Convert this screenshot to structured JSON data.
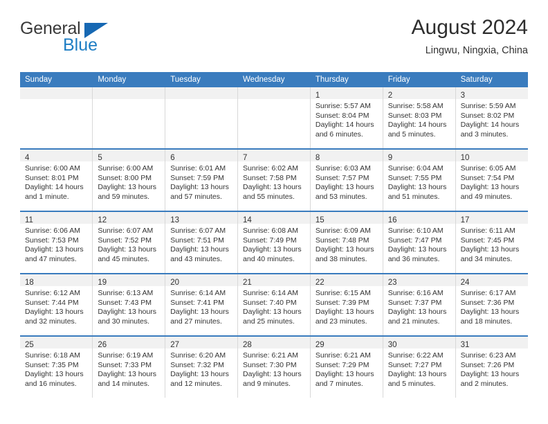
{
  "brand": {
    "name_part1": "General",
    "name_part2": "Blue",
    "triangle_color": "#1668b3",
    "blue_color": "#1f7ec4"
  },
  "header": {
    "title": "August 2024",
    "subtitle": "Lingwu, Ningxia, China"
  },
  "theme": {
    "header_blue": "#3a7cbe",
    "daynum_strip": "#f1f1f1",
    "text": "#333333"
  },
  "weekday_headers": [
    "Sunday",
    "Monday",
    "Tuesday",
    "Wednesday",
    "Thursday",
    "Friday",
    "Saturday"
  ],
  "labels": {
    "sunrise_prefix": "Sunrise:",
    "sunset_prefix": "Sunset:",
    "daylight_prefix": "Daylight:"
  },
  "weeks": [
    [
      {
        "day": "",
        "empty": true
      },
      {
        "day": "",
        "empty": true
      },
      {
        "day": "",
        "empty": true
      },
      {
        "day": "",
        "empty": true
      },
      {
        "day": "1",
        "sunrise": "Sunrise: 5:57 AM",
        "sunset": "Sunset: 8:04 PM",
        "daylight": "Daylight: 14 hours and 6 minutes."
      },
      {
        "day": "2",
        "sunrise": "Sunrise: 5:58 AM",
        "sunset": "Sunset: 8:03 PM",
        "daylight": "Daylight: 14 hours and 5 minutes."
      },
      {
        "day": "3",
        "sunrise": "Sunrise: 5:59 AM",
        "sunset": "Sunset: 8:02 PM",
        "daylight": "Daylight: 14 hours and 3 minutes."
      }
    ],
    [
      {
        "day": "4",
        "sunrise": "Sunrise: 6:00 AM",
        "sunset": "Sunset: 8:01 PM",
        "daylight": "Daylight: 14 hours and 1 minute."
      },
      {
        "day": "5",
        "sunrise": "Sunrise: 6:00 AM",
        "sunset": "Sunset: 8:00 PM",
        "daylight": "Daylight: 13 hours and 59 minutes."
      },
      {
        "day": "6",
        "sunrise": "Sunrise: 6:01 AM",
        "sunset": "Sunset: 7:59 PM",
        "daylight": "Daylight: 13 hours and 57 minutes."
      },
      {
        "day": "7",
        "sunrise": "Sunrise: 6:02 AM",
        "sunset": "Sunset: 7:58 PM",
        "daylight": "Daylight: 13 hours and 55 minutes."
      },
      {
        "day": "8",
        "sunrise": "Sunrise: 6:03 AM",
        "sunset": "Sunset: 7:57 PM",
        "daylight": "Daylight: 13 hours and 53 minutes."
      },
      {
        "day": "9",
        "sunrise": "Sunrise: 6:04 AM",
        "sunset": "Sunset: 7:55 PM",
        "daylight": "Daylight: 13 hours and 51 minutes."
      },
      {
        "day": "10",
        "sunrise": "Sunrise: 6:05 AM",
        "sunset": "Sunset: 7:54 PM",
        "daylight": "Daylight: 13 hours and 49 minutes."
      }
    ],
    [
      {
        "day": "11",
        "sunrise": "Sunrise: 6:06 AM",
        "sunset": "Sunset: 7:53 PM",
        "daylight": "Daylight: 13 hours and 47 minutes."
      },
      {
        "day": "12",
        "sunrise": "Sunrise: 6:07 AM",
        "sunset": "Sunset: 7:52 PM",
        "daylight": "Daylight: 13 hours and 45 minutes."
      },
      {
        "day": "13",
        "sunrise": "Sunrise: 6:07 AM",
        "sunset": "Sunset: 7:51 PM",
        "daylight": "Daylight: 13 hours and 43 minutes."
      },
      {
        "day": "14",
        "sunrise": "Sunrise: 6:08 AM",
        "sunset": "Sunset: 7:49 PM",
        "daylight": "Daylight: 13 hours and 40 minutes."
      },
      {
        "day": "15",
        "sunrise": "Sunrise: 6:09 AM",
        "sunset": "Sunset: 7:48 PM",
        "daylight": "Daylight: 13 hours and 38 minutes."
      },
      {
        "day": "16",
        "sunrise": "Sunrise: 6:10 AM",
        "sunset": "Sunset: 7:47 PM",
        "daylight": "Daylight: 13 hours and 36 minutes."
      },
      {
        "day": "17",
        "sunrise": "Sunrise: 6:11 AM",
        "sunset": "Sunset: 7:45 PM",
        "daylight": "Daylight: 13 hours and 34 minutes."
      }
    ],
    [
      {
        "day": "18",
        "sunrise": "Sunrise: 6:12 AM",
        "sunset": "Sunset: 7:44 PM",
        "daylight": "Daylight: 13 hours and 32 minutes."
      },
      {
        "day": "19",
        "sunrise": "Sunrise: 6:13 AM",
        "sunset": "Sunset: 7:43 PM",
        "daylight": "Daylight: 13 hours and 30 minutes."
      },
      {
        "day": "20",
        "sunrise": "Sunrise: 6:14 AM",
        "sunset": "Sunset: 7:41 PM",
        "daylight": "Daylight: 13 hours and 27 minutes."
      },
      {
        "day": "21",
        "sunrise": "Sunrise: 6:14 AM",
        "sunset": "Sunset: 7:40 PM",
        "daylight": "Daylight: 13 hours and 25 minutes."
      },
      {
        "day": "22",
        "sunrise": "Sunrise: 6:15 AM",
        "sunset": "Sunset: 7:39 PM",
        "daylight": "Daylight: 13 hours and 23 minutes."
      },
      {
        "day": "23",
        "sunrise": "Sunrise: 6:16 AM",
        "sunset": "Sunset: 7:37 PM",
        "daylight": "Daylight: 13 hours and 21 minutes."
      },
      {
        "day": "24",
        "sunrise": "Sunrise: 6:17 AM",
        "sunset": "Sunset: 7:36 PM",
        "daylight": "Daylight: 13 hours and 18 minutes."
      }
    ],
    [
      {
        "day": "25",
        "sunrise": "Sunrise: 6:18 AM",
        "sunset": "Sunset: 7:35 PM",
        "daylight": "Daylight: 13 hours and 16 minutes."
      },
      {
        "day": "26",
        "sunrise": "Sunrise: 6:19 AM",
        "sunset": "Sunset: 7:33 PM",
        "daylight": "Daylight: 13 hours and 14 minutes."
      },
      {
        "day": "27",
        "sunrise": "Sunrise: 6:20 AM",
        "sunset": "Sunset: 7:32 PM",
        "daylight": "Daylight: 13 hours and 12 minutes."
      },
      {
        "day": "28",
        "sunrise": "Sunrise: 6:21 AM",
        "sunset": "Sunset: 7:30 PM",
        "daylight": "Daylight: 13 hours and 9 minutes."
      },
      {
        "day": "29",
        "sunrise": "Sunrise: 6:21 AM",
        "sunset": "Sunset: 7:29 PM",
        "daylight": "Daylight: 13 hours and 7 minutes."
      },
      {
        "day": "30",
        "sunrise": "Sunrise: 6:22 AM",
        "sunset": "Sunset: 7:27 PM",
        "daylight": "Daylight: 13 hours and 5 minutes."
      },
      {
        "day": "31",
        "sunrise": "Sunrise: 6:23 AM",
        "sunset": "Sunset: 7:26 PM",
        "daylight": "Daylight: 13 hours and 2 minutes."
      }
    ]
  ]
}
